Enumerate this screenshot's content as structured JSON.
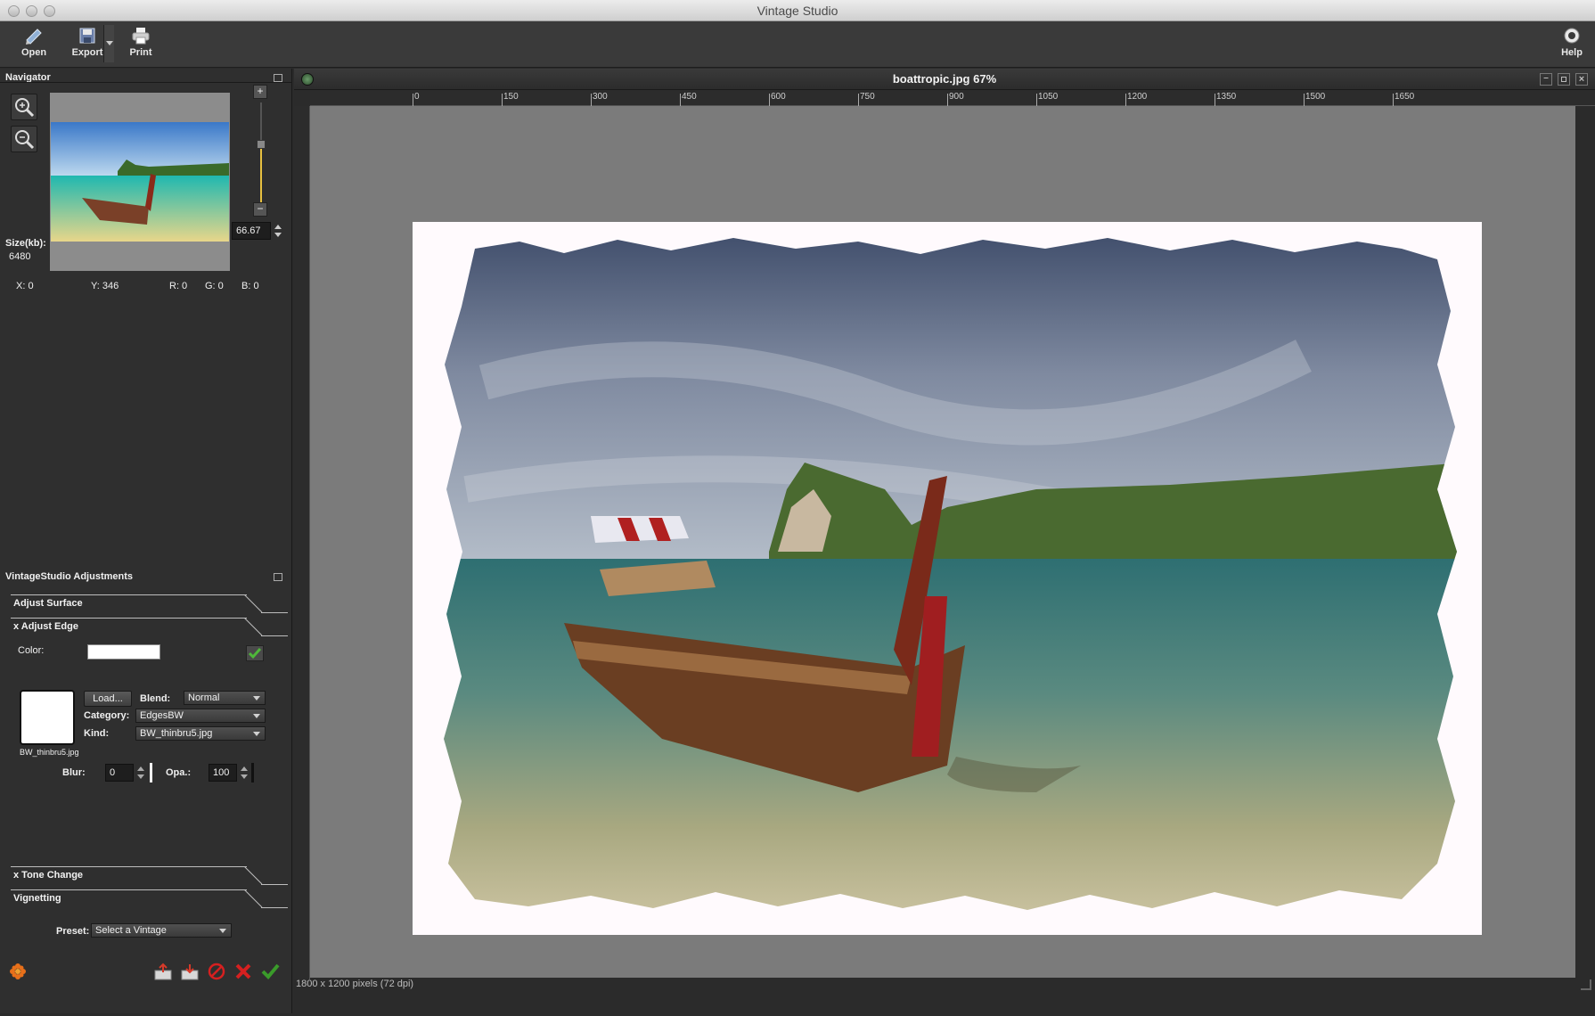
{
  "app": {
    "title": "Vintage Studio"
  },
  "toolbar": {
    "open_label": "Open",
    "export_label": "Export",
    "print_label": "Print",
    "help_label": "Help"
  },
  "navigator": {
    "title": "Navigator",
    "size_label": "Size(kb):",
    "size_value": "6480",
    "zoom_value": "66.67",
    "zoom_level_fraction": 0.55,
    "x_readout": "X: 0",
    "y_readout": "Y: 346",
    "r_readout": "R: 0",
    "g_readout": "G: 0",
    "b_readout": "B: 0"
  },
  "adjustments": {
    "title": "VintageStudio Adjustments",
    "sections": {
      "surface": "Adjust Surface",
      "edge": "x Adjust Edge",
      "tone": "x Tone Change",
      "vignetting": "Vignetting"
    },
    "edge": {
      "color_label": "Color:",
      "color_value": "#ffffff",
      "load_label": "Load...",
      "blend_label": "Blend:",
      "blend_value": "Normal",
      "category_label": "Category:",
      "category_value": "EdgesBW",
      "kind_label": "Kind:",
      "kind_value": "BW_thinbru5.jpg",
      "thumb_caption": "BW_thinbru5.jpg",
      "blur_label": "Blur:",
      "blur_value": "0",
      "opacity_label": "Opa.:",
      "opacity_value": "100"
    },
    "preset_label": "Preset:",
    "preset_value": "Select a Vintage"
  },
  "document": {
    "title": "boattropic.jpg 67%",
    "status": "1800 x 1200 pixels (72 dpi)",
    "ruler_h": [
      "0",
      "150",
      "300",
      "450",
      "600",
      "750",
      "900",
      "1050",
      "1200",
      "1350",
      "1500",
      "1650"
    ]
  },
  "colors": {
    "accent_yellow": "#e8c040",
    "ok_green": "#3a9b2a",
    "cancel_red": "#d62020"
  }
}
